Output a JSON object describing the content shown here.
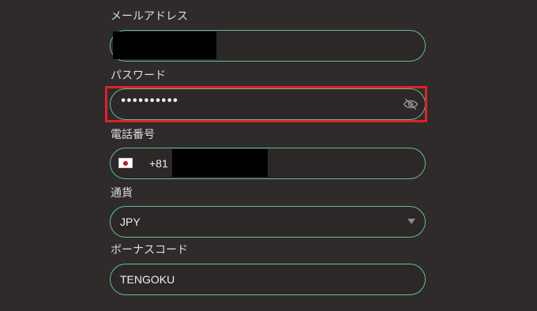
{
  "email": {
    "label": "メールアドレス",
    "value": ""
  },
  "password": {
    "label": "パスワード",
    "masked_value": "••••••••••",
    "toggle_icon": "eye-off-icon"
  },
  "phone": {
    "label": "電話番号",
    "flag_icon": "japan-flag-icon",
    "country_code": "+81"
  },
  "currency": {
    "label": "通貨",
    "selected": "JPY"
  },
  "bonus_code": {
    "label": "ボーナスコード",
    "value": "TENGOKU"
  },
  "colors": {
    "background": "#2e2b2a",
    "field_border": "#5fbf98",
    "highlight": "#e0202a"
  }
}
